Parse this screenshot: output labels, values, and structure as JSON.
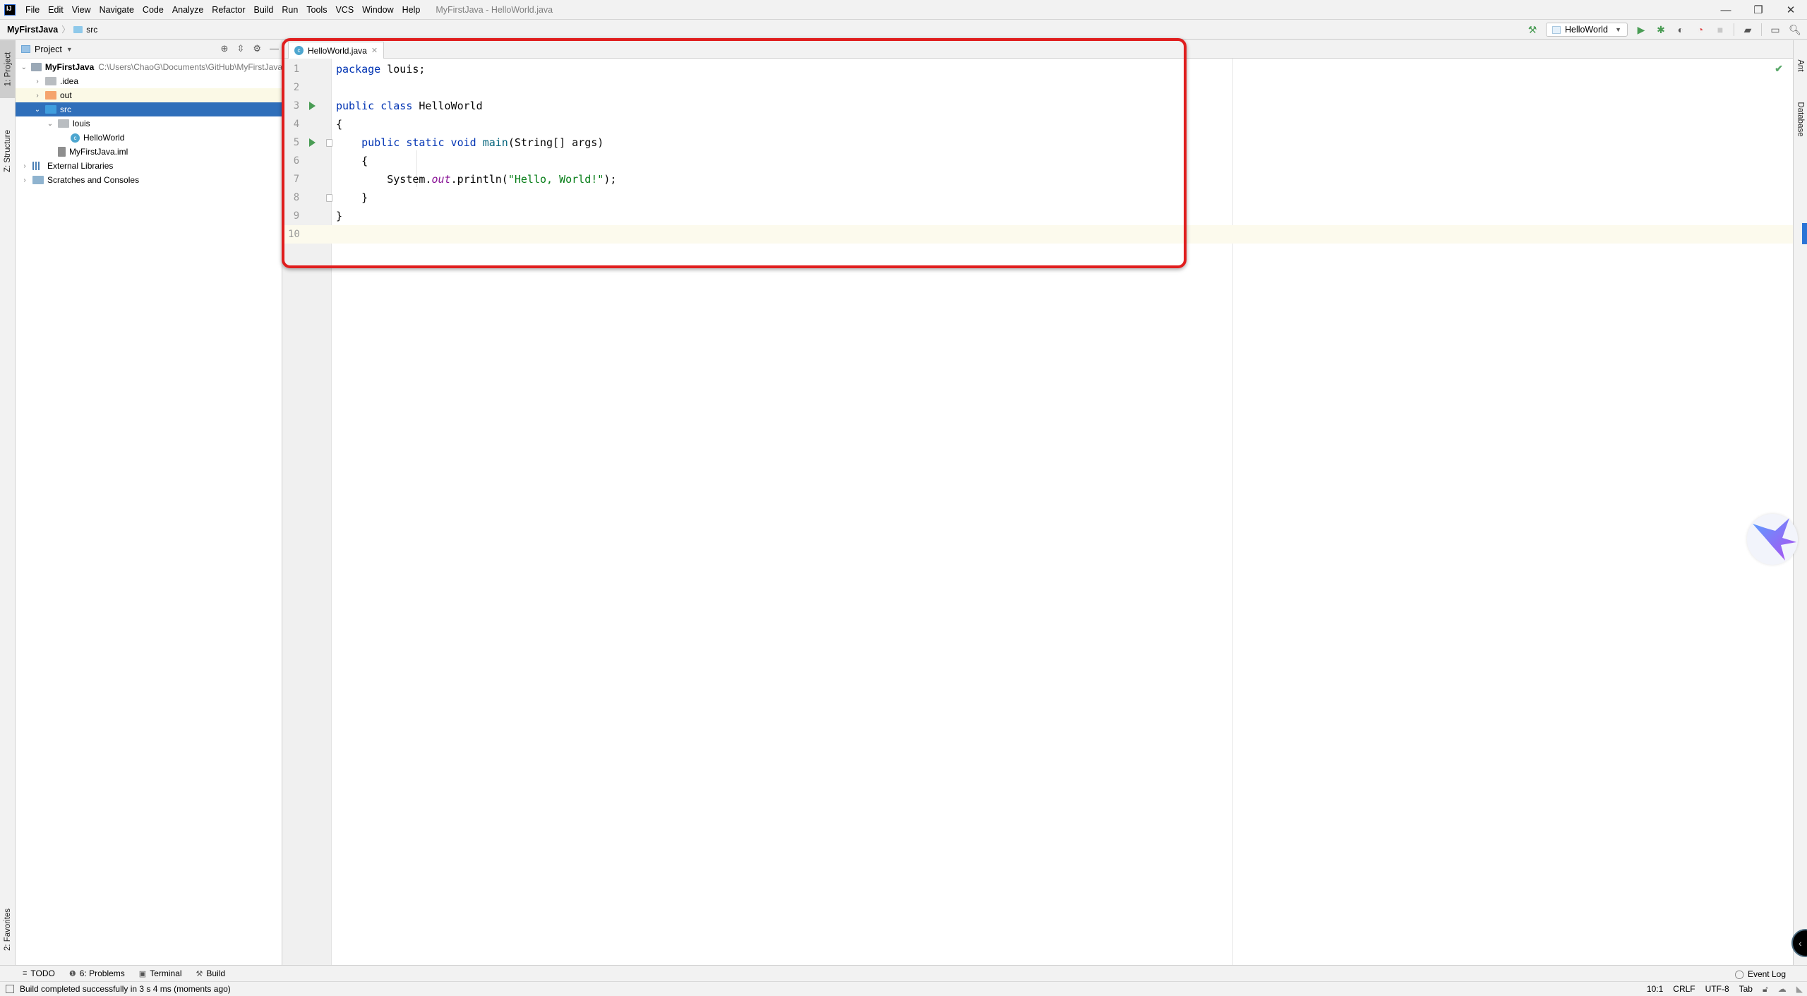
{
  "window": {
    "title": "MyFirstJava - HelloWorld.java",
    "controls": {
      "minimize": "—",
      "restore": "❐",
      "close": "✕"
    }
  },
  "menu": [
    {
      "label": "File",
      "mnemonic": "F"
    },
    {
      "label": "Edit",
      "mnemonic": "E"
    },
    {
      "label": "View",
      "mnemonic": "V"
    },
    {
      "label": "Navigate",
      "mnemonic": "N"
    },
    {
      "label": "Code",
      "mnemonic": "C"
    },
    {
      "label": "Analyze"
    },
    {
      "label": "Refactor",
      "mnemonic": "R"
    },
    {
      "label": "Build",
      "mnemonic": "B"
    },
    {
      "label": "Run"
    },
    {
      "label": "Tools",
      "mnemonic": "T"
    },
    {
      "label": "VCS"
    },
    {
      "label": "Window",
      "mnemonic": "W"
    },
    {
      "label": "Help",
      "mnemonic": "H"
    }
  ],
  "breadcrumb": {
    "root": "MyFirstJava",
    "child": "src"
  },
  "toolbar": {
    "run_config": "HelloWorld",
    "icons": [
      "build-hammer-icon",
      "run-icon",
      "debug-icon",
      "coverage-icon",
      "profiler-icon",
      "stop-icon",
      "project-structure-icon",
      "presentation-icon",
      "search-icon"
    ]
  },
  "left_tabs": {
    "project": "1: Project",
    "structure": "Z: Structure",
    "favorites": "2: Favorites"
  },
  "right_tabs": {
    "ant": "Ant",
    "database": "Database"
  },
  "project_panel": {
    "title": "Project",
    "tree": [
      {
        "label": "MyFirstJava",
        "path": "C:\\Users\\ChaoG\\Documents\\GitHub\\MyFirstJava",
        "expanded": true
      },
      {
        "label": ".idea",
        "expanded": false
      },
      {
        "label": "out",
        "expanded": false
      },
      {
        "label": "src",
        "expanded": true,
        "selected": true
      },
      {
        "label": "louis",
        "expanded": true
      },
      {
        "label": "HelloWorld"
      },
      {
        "label": "MyFirstJava.iml"
      },
      {
        "label": "External Libraries",
        "expanded": false
      },
      {
        "label": "Scratches and Consoles",
        "expanded": false
      }
    ]
  },
  "editor": {
    "tab": "HelloWorld.java",
    "current_line": 10,
    "lines": [
      {
        "n": "1",
        "tokens": [
          {
            "t": "package",
            "c": "kw"
          },
          {
            "t": " louis;",
            "c": "pl"
          }
        ]
      },
      {
        "n": "2",
        "tokens": []
      },
      {
        "n": "3",
        "tokens": [
          {
            "t": "public class",
            "c": "kw"
          },
          {
            "t": " HelloWorld",
            "c": "pl"
          }
        ]
      },
      {
        "n": "4",
        "tokens": [
          {
            "t": "{",
            "c": "pl"
          }
        ]
      },
      {
        "n": "5",
        "tokens": [
          {
            "t": "    public static void ",
            "c": "kw"
          },
          {
            "t": "main",
            "c": "mth"
          },
          {
            "t": "(String[] args)",
            "c": "pl"
          }
        ]
      },
      {
        "n": "6",
        "tokens": [
          {
            "t": "    {",
            "c": "pl"
          }
        ]
      },
      {
        "n": "7",
        "tokens": [
          {
            "t": "        System.",
            "c": "pl"
          },
          {
            "t": "out",
            "c": "static"
          },
          {
            "t": ".println(",
            "c": "pl"
          },
          {
            "t": "\"Hello, World!\"",
            "c": "str"
          },
          {
            "t": ");",
            "c": "pl"
          }
        ]
      },
      {
        "n": "8",
        "tokens": [
          {
            "t": "    }",
            "c": "pl"
          }
        ]
      },
      {
        "n": "9",
        "tokens": [
          {
            "t": "}",
            "c": "pl"
          }
        ]
      },
      {
        "n": "10",
        "tokens": []
      }
    ],
    "run_gutter_lines": [
      3,
      5
    ],
    "fold_lines": [
      5,
      8
    ]
  },
  "bottom_tools": [
    {
      "label": "TODO",
      "icon": "≡"
    },
    {
      "label": "6: Problems",
      "icon": "❶"
    },
    {
      "label": "Terminal",
      "icon": "▣"
    },
    {
      "label": "Build",
      "icon": "⚒"
    }
  ],
  "event_log": "Event Log",
  "status": {
    "message": "Build completed successfully in 3 s 4 ms (moments ago)",
    "position": "10:1",
    "line_sep": "CRLF",
    "encoding": "UTF-8",
    "indent": "Tab"
  }
}
